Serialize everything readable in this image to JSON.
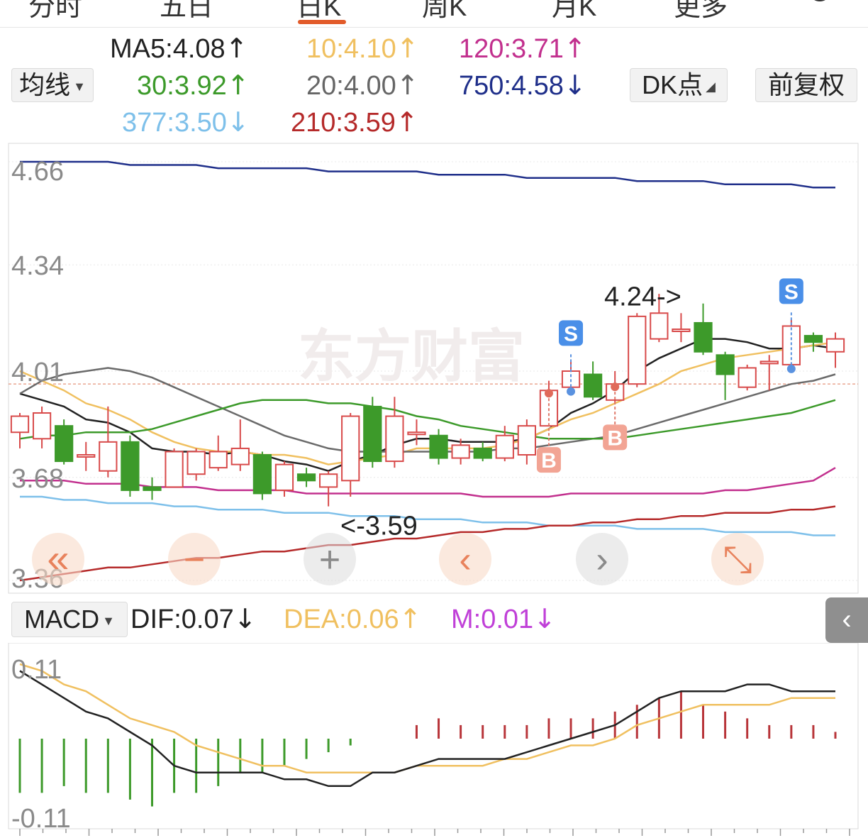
{
  "tabs": [
    {
      "label": "分时",
      "active": false
    },
    {
      "label": "五日",
      "active": false
    },
    {
      "label": "日K",
      "active": true
    },
    {
      "label": "周K",
      "active": false
    },
    {
      "label": "月K",
      "active": false
    },
    {
      "label": "更多",
      "active": false
    }
  ],
  "settings_icon": "gear-icon",
  "controls": {
    "ma_select": "均线",
    "dk_button": "DK点",
    "adjust_button": "前复权",
    "macd_select": "MACD"
  },
  "ma_values": [
    {
      "label": "MA5:4.08",
      "arrow": "↑",
      "color": "#222222"
    },
    {
      "label": "10:4.10",
      "arrow": "↑",
      "color": "#f0c060"
    },
    {
      "label": "120:3.71",
      "arrow": "↑",
      "color": "#c2308e"
    },
    {
      "label": "30:3.92",
      "arrow": "↑",
      "color": "#3c9a2a"
    },
    {
      "label": "20:4.00",
      "arrow": "↑",
      "color": "#666666"
    },
    {
      "label": "750:4.58",
      "arrow": "↓",
      "color": "#1f2f8a"
    },
    {
      "label": "377:3.50",
      "arrow": "↓",
      "color": "#7ec0ea"
    },
    {
      "label": "210:3.59",
      "arrow": "↑",
      "color": "#b52a2a"
    }
  ],
  "macd_values": [
    {
      "label": "DIF:0.07",
      "arrow": "↓",
      "color": "#222222"
    },
    {
      "label": "DEA:0.06",
      "arrow": "↑",
      "color": "#f0c060"
    },
    {
      "label": "M:0.01",
      "arrow": "↓",
      "color": "#c040d8"
    }
  ],
  "watermark": "东方财富",
  "chart_data": {
    "type": "candlestick",
    "price_axis_ticks": [
      "4.66",
      "4.34",
      "4.01",
      "3.68",
      "3.36"
    ],
    "ylim": [
      3.36,
      4.66
    ],
    "annotations": {
      "high_label": "4.24->",
      "low_label": "<-3.59"
    },
    "candles": [
      {
        "o": 3.82,
        "c": 3.87,
        "h": 3.88,
        "l": 3.77
      },
      {
        "o": 3.8,
        "c": 3.88,
        "h": 3.9,
        "l": 3.77
      },
      {
        "o": 3.84,
        "c": 3.73,
        "h": 3.86,
        "l": 3.72
      },
      {
        "o": 3.75,
        "c": 3.75,
        "h": 3.79,
        "l": 3.7
      },
      {
        "o": 3.7,
        "c": 3.79,
        "h": 3.9,
        "l": 3.68
      },
      {
        "o": 3.79,
        "c": 3.64,
        "h": 3.81,
        "l": 3.62
      },
      {
        "o": 3.65,
        "c": 3.64,
        "h": 3.68,
        "l": 3.61
      },
      {
        "o": 3.65,
        "c": 3.76,
        "h": 3.77,
        "l": 3.65
      },
      {
        "o": 3.69,
        "c": 3.76,
        "h": 3.77,
        "l": 3.67
      },
      {
        "o": 3.71,
        "c": 3.76,
        "h": 3.81,
        "l": 3.7
      },
      {
        "o": 3.72,
        "c": 3.77,
        "h": 3.86,
        "l": 3.7
      },
      {
        "o": 3.75,
        "c": 3.63,
        "h": 3.76,
        "l": 3.61
      },
      {
        "o": 3.64,
        "c": 3.72,
        "h": 3.73,
        "l": 3.62
      },
      {
        "o": 3.69,
        "c": 3.67,
        "h": 3.71,
        "l": 3.65
      },
      {
        "o": 3.65,
        "c": 3.69,
        "h": 3.7,
        "l": 3.59
      },
      {
        "o": 3.67,
        "c": 3.87,
        "h": 3.88,
        "l": 3.62
      },
      {
        "o": 3.9,
        "c": 3.73,
        "h": 3.93,
        "l": 3.71
      },
      {
        "o": 3.73,
        "c": 3.87,
        "h": 3.93,
        "l": 3.71
      },
      {
        "o": 3.82,
        "c": 3.82,
        "h": 3.86,
        "l": 3.78
      },
      {
        "o": 3.81,
        "c": 3.74,
        "h": 3.83,
        "l": 3.72
      },
      {
        "o": 3.74,
        "c": 3.78,
        "h": 3.8,
        "l": 3.72
      },
      {
        "o": 3.77,
        "c": 3.74,
        "h": 3.79,
        "l": 3.73
      },
      {
        "o": 3.74,
        "c": 3.81,
        "h": 3.84,
        "l": 3.73
      },
      {
        "o": 3.75,
        "c": 3.84,
        "h": 3.86,
        "l": 3.72
      },
      {
        "o": 3.84,
        "c": 3.95,
        "h": 3.98,
        "l": 3.84
      },
      {
        "o": 3.96,
        "c": 4.01,
        "h": 4.04,
        "l": 3.95
      },
      {
        "o": 4.0,
        "c": 3.93,
        "h": 4.04,
        "l": 3.92
      },
      {
        "o": 3.92,
        "c": 3.97,
        "h": 4.01,
        "l": 3.91
      },
      {
        "o": 3.97,
        "c": 4.18,
        "h": 4.19,
        "l": 3.96
      },
      {
        "o": 4.11,
        "c": 4.19,
        "h": 4.25,
        "l": 4.1
      },
      {
        "o": 4.14,
        "c": 4.14,
        "h": 4.19,
        "l": 4.1
      },
      {
        "o": 4.16,
        "c": 4.07,
        "h": 4.22,
        "l": 4.06
      },
      {
        "o": 4.06,
        "c": 4.0,
        "h": 4.07,
        "l": 3.92
      },
      {
        "o": 3.96,
        "c": 4.02,
        "h": 4.03,
        "l": 3.95
      },
      {
        "o": 4.04,
        "c": 4.04,
        "h": 4.06,
        "l": 3.95
      },
      {
        "o": 4.03,
        "c": 4.15,
        "h": 4.17,
        "l": 4.03
      },
      {
        "o": 4.12,
        "c": 4.1,
        "h": 4.13,
        "l": 4.07
      },
      {
        "o": 4.07,
        "c": 4.11,
        "h": 4.13,
        "l": 4.02
      }
    ],
    "signals": [
      {
        "type": "S",
        "index": 25
      },
      {
        "type": "B",
        "index": 24
      },
      {
        "type": "B",
        "index": 27
      },
      {
        "type": "S",
        "index": 35
      }
    ],
    "ma_series": [
      {
        "key": "MA5",
        "color": "#222222",
        "values": [
          3.94,
          3.92,
          3.9,
          3.86,
          3.85,
          3.82,
          3.77,
          3.76,
          3.76,
          3.75,
          3.76,
          3.75,
          3.73,
          3.72,
          3.7,
          3.73,
          3.75,
          3.78,
          3.8,
          3.8,
          3.79,
          3.79,
          3.79,
          3.8,
          3.83,
          3.88,
          3.91,
          3.95,
          4.01,
          4.05,
          4.08,
          4.11,
          4.11,
          4.1,
          4.08,
          4.08,
          4.09,
          4.08
        ]
      },
      {
        "key": "MA10",
        "color": "#f0c060",
        "values": [
          4.01,
          3.98,
          3.95,
          3.91,
          3.89,
          3.86,
          3.82,
          3.79,
          3.77,
          3.76,
          3.76,
          3.75,
          3.75,
          3.74,
          3.72,
          3.73,
          3.74,
          3.75,
          3.77,
          3.77,
          3.77,
          3.77,
          3.78,
          3.8,
          3.83,
          3.86,
          3.88,
          3.91,
          3.94,
          3.97,
          4.01,
          4.03,
          4.05,
          4.06,
          4.07,
          4.08,
          4.09,
          4.1
        ]
      },
      {
        "key": "MA20",
        "color": "#6a6a6a",
        "values": [
          3.94,
          3.98,
          4.0,
          4.01,
          4.02,
          4.01,
          3.99,
          3.96,
          3.93,
          3.9,
          3.87,
          3.84,
          3.81,
          3.79,
          3.77,
          3.76,
          3.76,
          3.76,
          3.76,
          3.76,
          3.76,
          3.76,
          3.77,
          3.77,
          3.78,
          3.79,
          3.8,
          3.81,
          3.83,
          3.85,
          3.87,
          3.89,
          3.91,
          3.93,
          3.95,
          3.97,
          3.98,
          4.0
        ]
      },
      {
        "key": "MA30",
        "color": "#3c9a2a",
        "values": [
          3.8,
          3.81,
          3.81,
          3.82,
          3.82,
          3.82,
          3.83,
          3.85,
          3.87,
          3.89,
          3.91,
          3.92,
          3.92,
          3.92,
          3.91,
          3.91,
          3.9,
          3.89,
          3.87,
          3.86,
          3.84,
          3.83,
          3.82,
          3.81,
          3.8,
          3.8,
          3.8,
          3.8,
          3.81,
          3.82,
          3.83,
          3.84,
          3.85,
          3.86,
          3.87,
          3.88,
          3.9,
          3.92
        ]
      },
      {
        "key": "MA120",
        "color": "#c2308e",
        "values": [
          3.67,
          3.67,
          3.67,
          3.66,
          3.66,
          3.66,
          3.65,
          3.65,
          3.65,
          3.64,
          3.64,
          3.64,
          3.64,
          3.63,
          3.63,
          3.63,
          3.63,
          3.63,
          3.63,
          3.63,
          3.63,
          3.62,
          3.62,
          3.62,
          3.62,
          3.63,
          3.63,
          3.63,
          3.63,
          3.63,
          3.63,
          3.63,
          3.64,
          3.64,
          3.65,
          3.66,
          3.67,
          3.71
        ]
      },
      {
        "key": "MA750",
        "color": "#1f2f8a",
        "values": [
          4.66,
          4.66,
          4.66,
          4.66,
          4.66,
          4.65,
          4.65,
          4.65,
          4.65,
          4.64,
          4.64,
          4.64,
          4.64,
          4.64,
          4.63,
          4.63,
          4.63,
          4.63,
          4.63,
          4.62,
          4.62,
          4.62,
          4.62,
          4.61,
          4.61,
          4.61,
          4.61,
          4.61,
          4.6,
          4.6,
          4.6,
          4.6,
          4.59,
          4.59,
          4.59,
          4.59,
          4.58,
          4.58
        ]
      },
      {
        "key": "MA377",
        "color": "#7ec0ea",
        "values": [
          3.62,
          3.62,
          3.61,
          3.61,
          3.6,
          3.6,
          3.6,
          3.59,
          3.59,
          3.58,
          3.58,
          3.58,
          3.57,
          3.57,
          3.57,
          3.56,
          3.56,
          3.56,
          3.55,
          3.55,
          3.55,
          3.54,
          3.54,
          3.54,
          3.53,
          3.53,
          3.53,
          3.53,
          3.52,
          3.52,
          3.52,
          3.52,
          3.51,
          3.51,
          3.51,
          3.51,
          3.5,
          3.5
        ]
      },
      {
        "key": "MA210",
        "color": "#b52a2a",
        "values": [
          3.36,
          3.37,
          3.38,
          3.39,
          3.4,
          3.4,
          3.41,
          3.42,
          3.43,
          3.43,
          3.44,
          3.45,
          3.45,
          3.46,
          3.47,
          3.47,
          3.48,
          3.49,
          3.49,
          3.5,
          3.51,
          3.51,
          3.52,
          3.52,
          3.53,
          3.53,
          3.54,
          3.54,
          3.55,
          3.55,
          3.56,
          3.56,
          3.57,
          3.57,
          3.57,
          3.58,
          3.58,
          3.59
        ]
      }
    ],
    "macd": {
      "axis_ticks": [
        "0.11",
        "-0.11"
      ],
      "ylim": [
        -0.11,
        0.11
      ],
      "dif": [
        0.1,
        0.08,
        0.06,
        0.04,
        0.03,
        0.01,
        -0.01,
        -0.04,
        -0.05,
        -0.05,
        -0.05,
        -0.05,
        -0.06,
        -0.06,
        -0.07,
        -0.07,
        -0.05,
        -0.05,
        -0.04,
        -0.03,
        -0.03,
        -0.03,
        -0.03,
        -0.02,
        -0.01,
        0.0,
        0.01,
        0.02,
        0.04,
        0.06,
        0.07,
        0.07,
        0.07,
        0.08,
        0.08,
        0.07,
        0.07,
        0.07
      ],
      "dea": [
        0.11,
        0.1,
        0.08,
        0.07,
        0.05,
        0.03,
        0.02,
        0.01,
        -0.01,
        -0.02,
        -0.03,
        -0.04,
        -0.04,
        -0.05,
        -0.05,
        -0.05,
        -0.05,
        -0.05,
        -0.04,
        -0.04,
        -0.04,
        -0.04,
        -0.03,
        -0.03,
        -0.02,
        -0.01,
        -0.01,
        0.0,
        0.02,
        0.03,
        0.04,
        0.05,
        0.05,
        0.05,
        0.05,
        0.06,
        0.06,
        0.06
      ],
      "hist": [
        -0.08,
        -0.08,
        -0.07,
        -0.08,
        -0.08,
        -0.09,
        -0.1,
        -0.08,
        -0.08,
        -0.07,
        -0.05,
        -0.05,
        -0.04,
        -0.03,
        -0.02,
        -0.01,
        0.0,
        0.0,
        0.02,
        0.03,
        0.02,
        0.02,
        0.02,
        0.02,
        0.03,
        0.03,
        0.03,
        0.04,
        0.05,
        0.06,
        0.07,
        0.05,
        0.04,
        0.03,
        0.02,
        0.02,
        0.02,
        0.01
      ]
    }
  },
  "nav_buttons": [
    {
      "name": "fast-back-icon",
      "glyph": "«"
    },
    {
      "name": "zoom-out-icon",
      "glyph": "−"
    },
    {
      "name": "zoom-in-icon",
      "glyph": "+"
    },
    {
      "name": "step-left-icon",
      "glyph": "‹"
    },
    {
      "name": "step-right-icon",
      "glyph": "›"
    },
    {
      "name": "fullscreen-icon",
      "glyph": "⤡"
    }
  ],
  "side_tab_icon": "chevron-left-icon"
}
